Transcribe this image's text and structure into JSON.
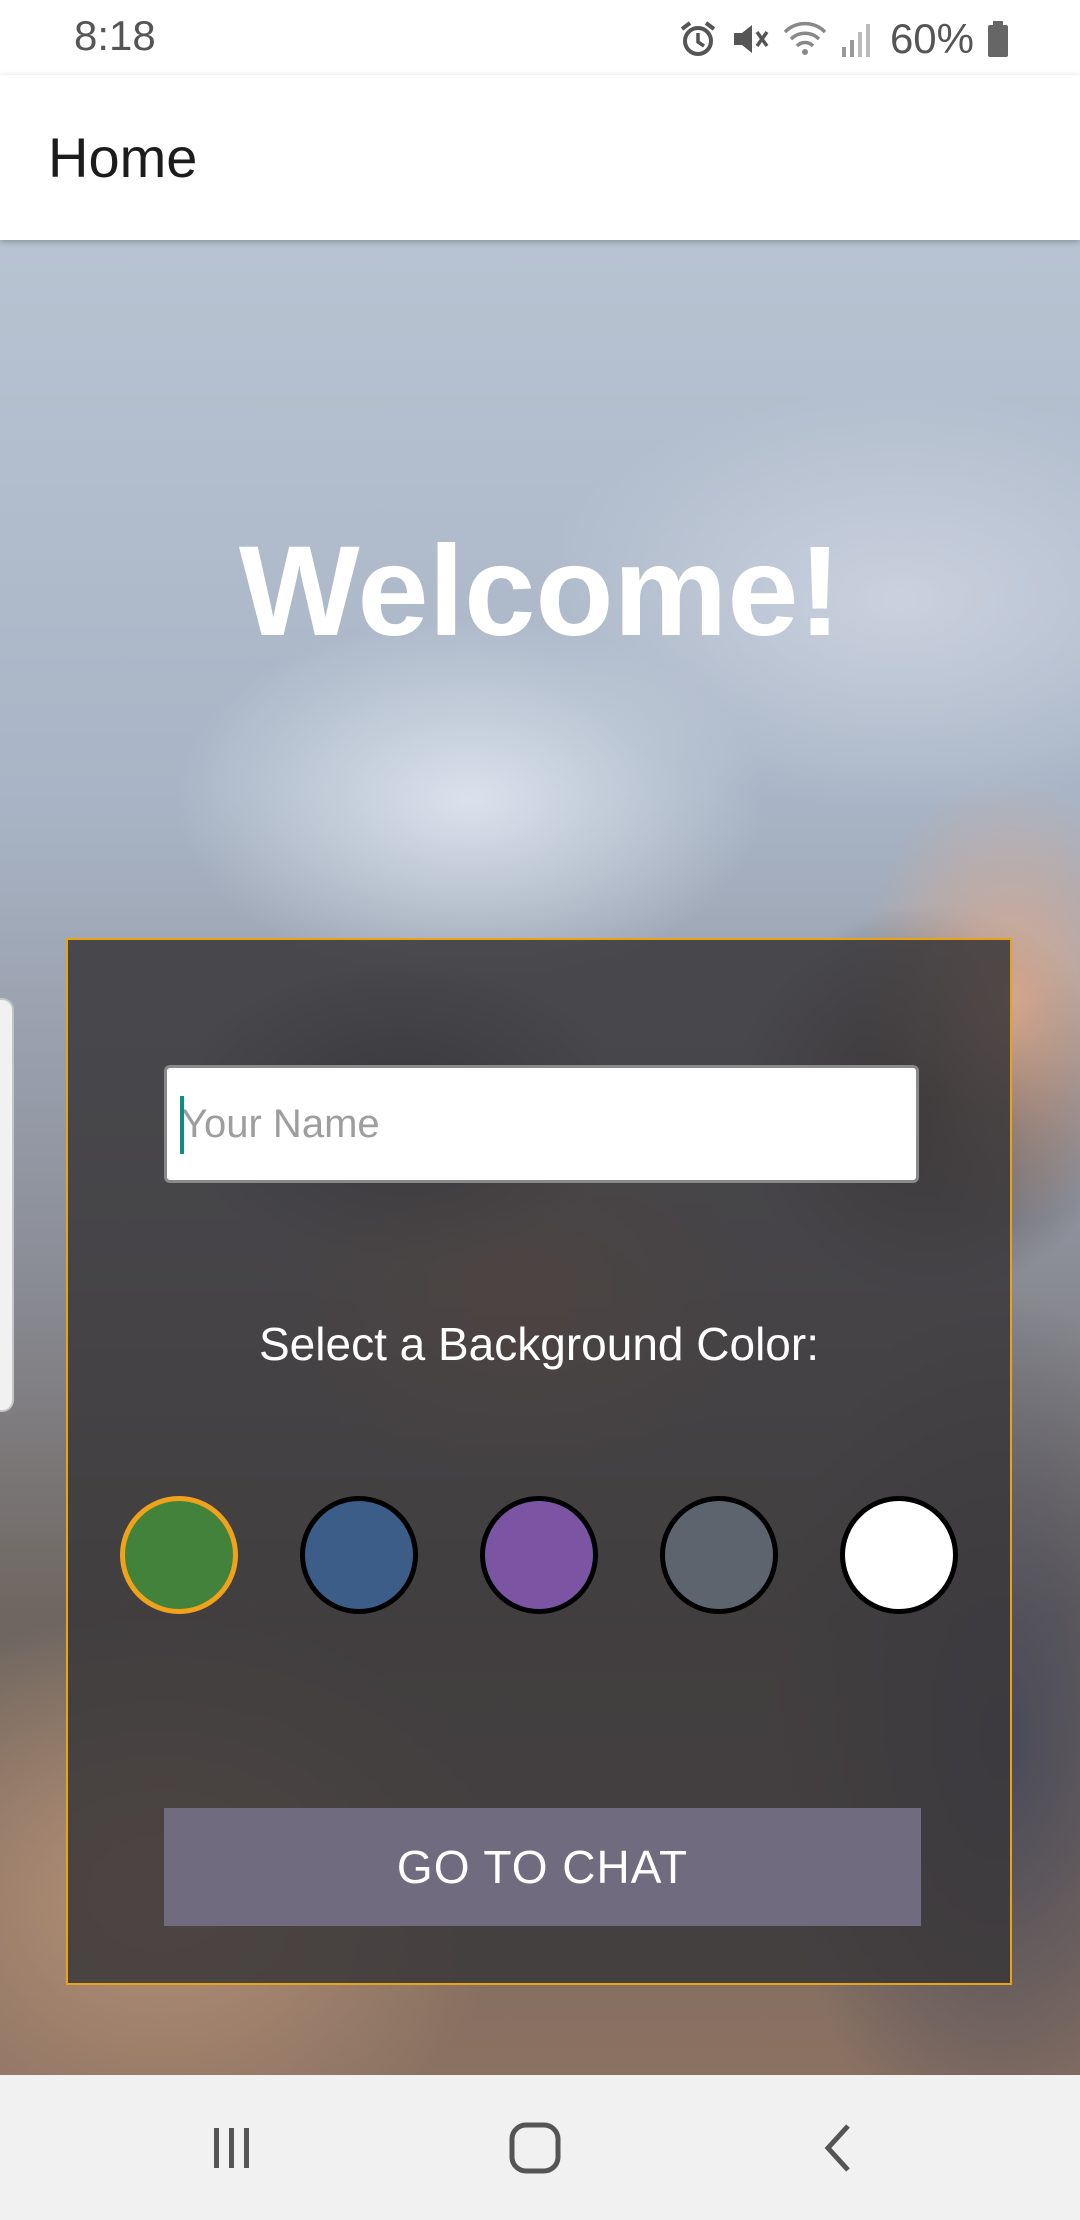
{
  "status_bar": {
    "time": "8:18",
    "battery_text": "60%",
    "icons": [
      "alarm-icon",
      "mute-icon",
      "wifi-icon",
      "signal-icon",
      "battery-icon"
    ]
  },
  "app_bar": {
    "title": "Home"
  },
  "hero": {
    "welcome_text": "Welcome!"
  },
  "form": {
    "name_placeholder": "Your Name",
    "name_value": "",
    "color_label": "Select a Background Color:",
    "swatches": [
      {
        "color": "#43823a",
        "selected": true
      },
      {
        "color": "#3b5d87",
        "selected": false
      },
      {
        "color": "#7b55a3",
        "selected": false
      },
      {
        "color": "#5e646d",
        "selected": false
      },
      {
        "color": "#ffffff",
        "selected": false
      }
    ],
    "selected_border_color": "#f0a21b",
    "button_label": "GO TO CHAT",
    "button_color": "#716b80"
  },
  "nav_bar": {
    "buttons": [
      "recents-icon",
      "home-icon",
      "back-icon"
    ]
  }
}
